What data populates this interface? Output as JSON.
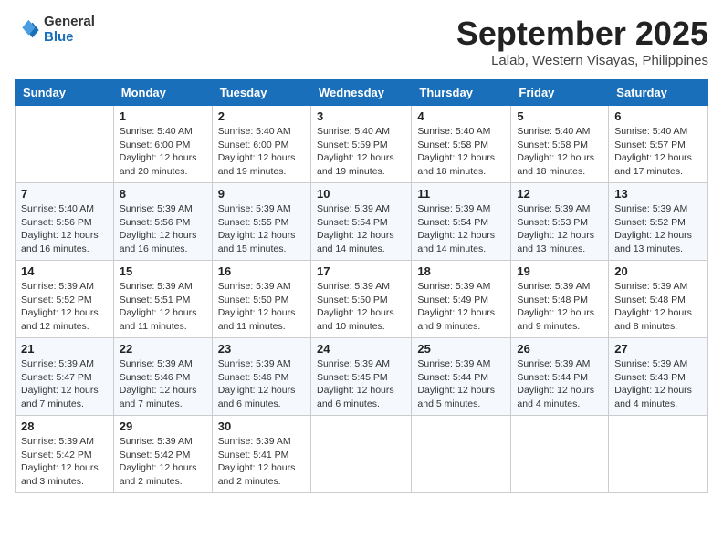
{
  "logo": {
    "general": "General",
    "blue": "Blue"
  },
  "header": {
    "month": "September 2025",
    "location": "Lalab, Western Visayas, Philippines"
  },
  "weekdays": [
    "Sunday",
    "Monday",
    "Tuesday",
    "Wednesday",
    "Thursday",
    "Friday",
    "Saturday"
  ],
  "weeks": [
    [
      {
        "day": "",
        "info": ""
      },
      {
        "day": "1",
        "info": "Sunrise: 5:40 AM\nSunset: 6:00 PM\nDaylight: 12 hours\nand 20 minutes."
      },
      {
        "day": "2",
        "info": "Sunrise: 5:40 AM\nSunset: 6:00 PM\nDaylight: 12 hours\nand 19 minutes."
      },
      {
        "day": "3",
        "info": "Sunrise: 5:40 AM\nSunset: 5:59 PM\nDaylight: 12 hours\nand 19 minutes."
      },
      {
        "day": "4",
        "info": "Sunrise: 5:40 AM\nSunset: 5:58 PM\nDaylight: 12 hours\nand 18 minutes."
      },
      {
        "day": "5",
        "info": "Sunrise: 5:40 AM\nSunset: 5:58 PM\nDaylight: 12 hours\nand 18 minutes."
      },
      {
        "day": "6",
        "info": "Sunrise: 5:40 AM\nSunset: 5:57 PM\nDaylight: 12 hours\nand 17 minutes."
      }
    ],
    [
      {
        "day": "7",
        "info": "Sunrise: 5:40 AM\nSunset: 5:56 PM\nDaylight: 12 hours\nand 16 minutes."
      },
      {
        "day": "8",
        "info": "Sunrise: 5:39 AM\nSunset: 5:56 PM\nDaylight: 12 hours\nand 16 minutes."
      },
      {
        "day": "9",
        "info": "Sunrise: 5:39 AM\nSunset: 5:55 PM\nDaylight: 12 hours\nand 15 minutes."
      },
      {
        "day": "10",
        "info": "Sunrise: 5:39 AM\nSunset: 5:54 PM\nDaylight: 12 hours\nand 14 minutes."
      },
      {
        "day": "11",
        "info": "Sunrise: 5:39 AM\nSunset: 5:54 PM\nDaylight: 12 hours\nand 14 minutes."
      },
      {
        "day": "12",
        "info": "Sunrise: 5:39 AM\nSunset: 5:53 PM\nDaylight: 12 hours\nand 13 minutes."
      },
      {
        "day": "13",
        "info": "Sunrise: 5:39 AM\nSunset: 5:52 PM\nDaylight: 12 hours\nand 13 minutes."
      }
    ],
    [
      {
        "day": "14",
        "info": "Sunrise: 5:39 AM\nSunset: 5:52 PM\nDaylight: 12 hours\nand 12 minutes."
      },
      {
        "day": "15",
        "info": "Sunrise: 5:39 AM\nSunset: 5:51 PM\nDaylight: 12 hours\nand 11 minutes."
      },
      {
        "day": "16",
        "info": "Sunrise: 5:39 AM\nSunset: 5:50 PM\nDaylight: 12 hours\nand 11 minutes."
      },
      {
        "day": "17",
        "info": "Sunrise: 5:39 AM\nSunset: 5:50 PM\nDaylight: 12 hours\nand 10 minutes."
      },
      {
        "day": "18",
        "info": "Sunrise: 5:39 AM\nSunset: 5:49 PM\nDaylight: 12 hours\nand 9 minutes."
      },
      {
        "day": "19",
        "info": "Sunrise: 5:39 AM\nSunset: 5:48 PM\nDaylight: 12 hours\nand 9 minutes."
      },
      {
        "day": "20",
        "info": "Sunrise: 5:39 AM\nSunset: 5:48 PM\nDaylight: 12 hours\nand 8 minutes."
      }
    ],
    [
      {
        "day": "21",
        "info": "Sunrise: 5:39 AM\nSunset: 5:47 PM\nDaylight: 12 hours\nand 7 minutes."
      },
      {
        "day": "22",
        "info": "Sunrise: 5:39 AM\nSunset: 5:46 PM\nDaylight: 12 hours\nand 7 minutes."
      },
      {
        "day": "23",
        "info": "Sunrise: 5:39 AM\nSunset: 5:46 PM\nDaylight: 12 hours\nand 6 minutes."
      },
      {
        "day": "24",
        "info": "Sunrise: 5:39 AM\nSunset: 5:45 PM\nDaylight: 12 hours\nand 6 minutes."
      },
      {
        "day": "25",
        "info": "Sunrise: 5:39 AM\nSunset: 5:44 PM\nDaylight: 12 hours\nand 5 minutes."
      },
      {
        "day": "26",
        "info": "Sunrise: 5:39 AM\nSunset: 5:44 PM\nDaylight: 12 hours\nand 4 minutes."
      },
      {
        "day": "27",
        "info": "Sunrise: 5:39 AM\nSunset: 5:43 PM\nDaylight: 12 hours\nand 4 minutes."
      }
    ],
    [
      {
        "day": "28",
        "info": "Sunrise: 5:39 AM\nSunset: 5:42 PM\nDaylight: 12 hours\nand 3 minutes."
      },
      {
        "day": "29",
        "info": "Sunrise: 5:39 AM\nSunset: 5:42 PM\nDaylight: 12 hours\nand 2 minutes."
      },
      {
        "day": "30",
        "info": "Sunrise: 5:39 AM\nSunset: 5:41 PM\nDaylight: 12 hours\nand 2 minutes."
      },
      {
        "day": "",
        "info": ""
      },
      {
        "day": "",
        "info": ""
      },
      {
        "day": "",
        "info": ""
      },
      {
        "day": "",
        "info": ""
      }
    ]
  ]
}
